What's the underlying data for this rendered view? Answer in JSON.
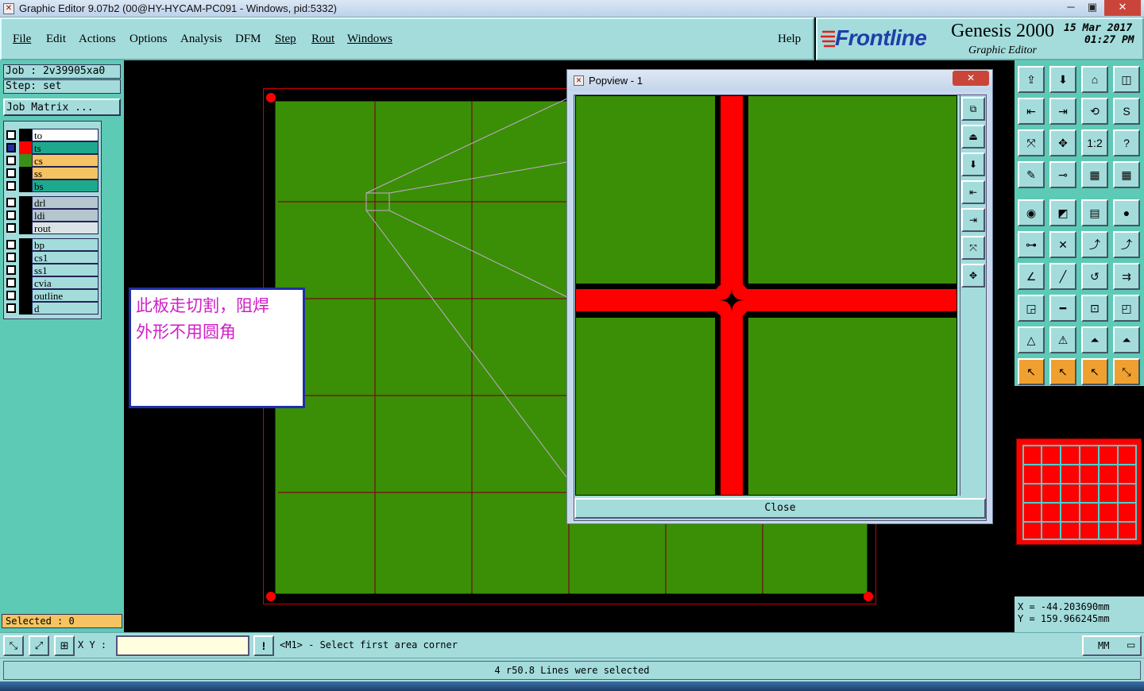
{
  "window": {
    "title": "Graphic Editor 9.07b2 (00@HY-HYCAM-PC091 - Windows, pid:5332)",
    "minimize": "─",
    "maximize": "▣",
    "close": "✕"
  },
  "menu": {
    "items": [
      "File",
      "Edit",
      "Actions",
      "Options",
      "Analysis",
      "DFM",
      "Step",
      "Rout",
      "Windows"
    ],
    "help": "Help"
  },
  "brand": {
    "logo": "Frontline",
    "product": "Genesis 2000",
    "subtitle": "Graphic Editor",
    "date": "15 Mar 2017",
    "time": "01:27 PM"
  },
  "job": {
    "job_label": "Job : 2v39905xa0",
    "step_label": "Step: set",
    "matrix_button": "Job Matrix ..."
  },
  "layers": {
    "group1": [
      {
        "name": "to",
        "color": "#ffffff",
        "swatch": "#000000"
      },
      {
        "name": "ts",
        "color": "#1ea88e",
        "swatch": "#ff0000",
        "active": true
      },
      {
        "name": "cs",
        "color": "#f5c361",
        "swatch": "#3a8f1a"
      },
      {
        "name": "ss",
        "color": "#f5c361",
        "swatch": "#000000"
      },
      {
        "name": "bs",
        "color": "#1ea88e",
        "swatch": "#000000"
      }
    ],
    "group2": [
      {
        "name": "drl",
        "color": "#b4c7cf",
        "swatch": "#000000"
      },
      {
        "name": "ldi",
        "color": "#b4c7cf",
        "swatch": "#000000"
      },
      {
        "name": "rout",
        "color": "#dbe3e6",
        "swatch": "#000000"
      }
    ],
    "group3": [
      {
        "name": "bp",
        "color": "#a4dcdc",
        "swatch": "#000000"
      },
      {
        "name": "cs1",
        "color": "#a4dcdc",
        "swatch": "#000000"
      },
      {
        "name": "ss1",
        "color": "#a4dcdc",
        "swatch": "#000000"
      },
      {
        "name": "cvia",
        "color": "#a4dcdc",
        "swatch": "#000000"
      },
      {
        "name": "outline",
        "color": "#a4dcdc",
        "swatch": "#000000"
      },
      {
        "name": "d",
        "color": "#a4dcdc",
        "swatch": "#000000"
      }
    ]
  },
  "selected": "Selected : 0",
  "note": {
    "line1": "此板走切割，阻焊",
    "line2": "外形不用圆角"
  },
  "popview": {
    "title": "Popview - 1",
    "close_label": "Close"
  },
  "coords": {
    "x": "X = -44.203690mm",
    "y": "Y = 159.966245mm"
  },
  "command": {
    "xy_label": "X Y :",
    "xy_value": "",
    "prompt": "<M1> - Select first area corner",
    "units": "MM"
  },
  "status": "4 r50.8 Lines were selected",
  "colors": {
    "panel": "#a4dcdc",
    "sidebar": "#5dcab6",
    "board_fill": "#3a8f06",
    "trace": "#ff0000",
    "grid_line": "#7a0a16"
  }
}
